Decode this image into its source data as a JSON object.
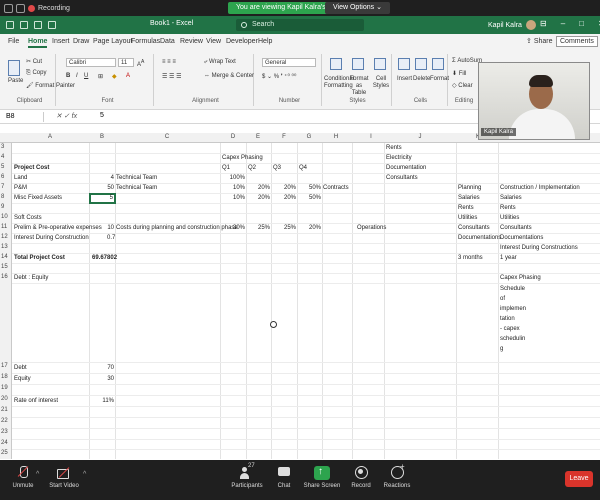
{
  "zoom": {
    "recording_label": "Recording",
    "viewing_banner": "You are viewing Kapil Kalra's screen",
    "view_options": "View Options",
    "participants_count": "27",
    "toolbar": [
      {
        "label": "Unmute",
        "icon": "mic-muted-icon"
      },
      {
        "label": "Start Video",
        "icon": "camera-off-icon"
      },
      {
        "label": "Participants",
        "icon": "participants-icon"
      },
      {
        "label": "Chat",
        "icon": "chat-icon"
      },
      {
        "label": "Share Screen",
        "icon": "share-screen-icon"
      },
      {
        "label": "Record",
        "icon": "record-icon"
      },
      {
        "label": "Reactions",
        "icon": "reactions-icon"
      }
    ],
    "leave_label": "Leave",
    "presenter_name": "Kapil Kalra"
  },
  "excel": {
    "book_title": "Book1 - Excel",
    "search_placeholder": "Search",
    "user_name": "Kapil Kalra",
    "user_initials": "KK",
    "tabs": [
      "File",
      "Home",
      "Insert",
      "Draw",
      "Page Layout",
      "Formulas",
      "Data",
      "Review",
      "View",
      "Developer",
      "Help"
    ],
    "active_tab": "Home",
    "share_label": "Share",
    "comments_label": "Comments",
    "ribbon": {
      "clipboard": {
        "name": "Clipboard",
        "paste": "Paste",
        "cut": "Cut",
        "copy": "Copy",
        "format_painter": "Format Painter"
      },
      "font": {
        "name": "Font",
        "font_family": "Calibri",
        "font_size": "11"
      },
      "alignment": {
        "name": "Alignment",
        "wrap_text": "Wrap Text",
        "merge_center": "Merge & Center"
      },
      "number": {
        "name": "Number",
        "format": "General"
      },
      "styles": {
        "name": "Styles",
        "conditional": "Conditional Formatting",
        "format_table": "Format as Table",
        "cell_styles": "Cell Styles"
      },
      "cells": {
        "name": "Cells",
        "insert": "Insert",
        "delete": "Delete",
        "format": "Format"
      },
      "editing": {
        "name": "Editing",
        "autosum": "AutoSum",
        "fill": "Fill",
        "clear": "Clear"
      }
    },
    "name_box": "B8",
    "formula_value": "5",
    "columns": [
      "A",
      "B",
      "C",
      "D",
      "E",
      "F",
      "G",
      "H",
      "I",
      "J",
      "K",
      "L"
    ],
    "rows": [
      "3",
      "4",
      "5",
      "6",
      "7",
      "8",
      "9",
      "10",
      "11",
      "12",
      "13",
      "14",
      "15",
      "16",
      "17",
      "18",
      "19",
      "20",
      "21",
      "22",
      "23",
      "24",
      "25"
    ],
    "cells": {
      "J3": "Rents",
      "J4": "Electricity",
      "D4": "Capex Phasing",
      "A5": "Project Cost",
      "D5": "Q1",
      "E5": "Q2",
      "F5": "Q3",
      "G5": "Q4",
      "J5": "Documentation",
      "A6": "Land",
      "B6": "4",
      "C6": "Technical Team",
      "D6": "100%",
      "J6": "Consultants",
      "A7": "P&M",
      "B7": "50",
      "C7": "Technical Team",
      "D7": "10%",
      "E7": "20%",
      "F7": "20%",
      "G7": "50%",
      "H7": "Contracts",
      "K7": "Planning",
      "L7": "Construction / Implementation",
      "A8": "Misc Fixed Assets",
      "B8": "5",
      "D8": "10%",
      "E8": "20%",
      "F8": "20%",
      "G8": "50%",
      "K8": "Salaries",
      "L8": "Salaries",
      "K9": "Rents",
      "L9": "Rents",
      "A10": "Soft Costs",
      "K10": "Utilities",
      "L10": "Utilities",
      "A11": "Prelim & Pre-operative expenses",
      "B11": "10",
      "C11": "Costs during planning and construction phase",
      "D11": "30%",
      "E11": "25%",
      "F11": "25%",
      "G11": "20%",
      "I11": "Operations",
      "K11": "Consultants",
      "L11": "Consultants",
      "A12": "Interest During Construction",
      "B12": "0.7",
      "K12": "Documentations",
      "L12": "Documentations",
      "L13": "Interest During Constructions",
      "A14": "Total Project Cost",
      "B14": "69.67802",
      "K14": "3 months",
      "L14": "1 year",
      "A16": "Debt : Equity",
      "L16": "Capex Phasing",
      "L16b": [
        "Schedule",
        "of",
        "implemen",
        "tation",
        "- capex",
        "schedulin",
        "g"
      ],
      "A17": "Debt",
      "B17": "70",
      "A18": "Equity",
      "B18": "30",
      "A20": "Rate onf interest",
      "B20": "11%"
    }
  }
}
